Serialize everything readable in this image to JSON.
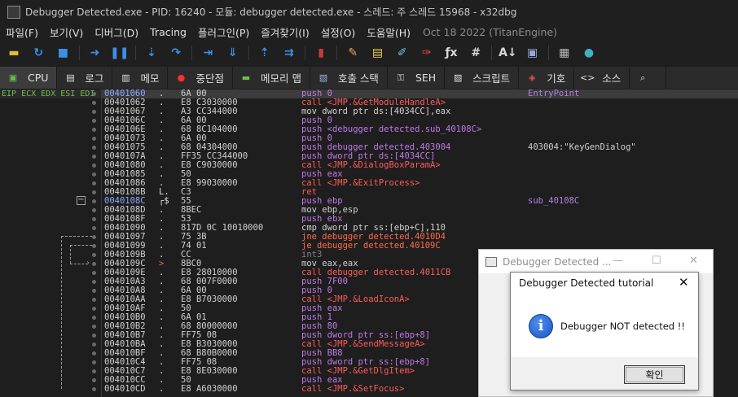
{
  "window": {
    "title": "Debugger Detected.exe - PID: 16240 - 모듈: debugger detected.exe - 스레드: 주 스레드 15968 - x32dbg"
  },
  "menu": {
    "items": [
      "파일(F)",
      "보기(V)",
      "디버그(D)",
      "Tracing",
      "플러그인(P)",
      "즐겨찾기(I)",
      "설정(O)",
      "도움말(H)"
    ],
    "engine": "Oct 18 2022 (TitanEngine)"
  },
  "toolbar": {
    "buttons": [
      {
        "name": "open-icon",
        "glyph": "▬",
        "color": "#e8b838"
      },
      {
        "name": "restart-icon",
        "glyph": "↻",
        "color": "#3c8fe8"
      },
      {
        "name": "stop-icon",
        "glyph": "■",
        "color": "#3c8fe8"
      },
      {
        "name": "sep"
      },
      {
        "name": "run-icon",
        "glyph": "➜",
        "color": "#3c8fe8"
      },
      {
        "name": "pause-icon",
        "glyph": "❚❚",
        "color": "#3c8fe8"
      },
      {
        "name": "sep"
      },
      {
        "name": "step-into-icon",
        "glyph": "⇣",
        "color": "#3c8fe8"
      },
      {
        "name": "step-over-icon",
        "glyph": "↷",
        "color": "#3c8fe8"
      },
      {
        "name": "sep"
      },
      {
        "name": "trace-into-icon",
        "glyph": "⇥",
        "color": "#3c8fe8"
      },
      {
        "name": "trace-over-icon",
        "glyph": "⇓",
        "color": "#3c8fe8"
      },
      {
        "name": "sep"
      },
      {
        "name": "execute-till-return-icon",
        "glyph": "⇡",
        "color": "#3c8fe8"
      },
      {
        "name": "run-to-user-code-icon",
        "glyph": "⇉",
        "color": "#3c8fe8"
      },
      {
        "name": "sep"
      },
      {
        "name": "scylla-icon",
        "glyph": "▮",
        "color": "#c83c3c"
      },
      {
        "name": "sep"
      },
      {
        "name": "patch-icon",
        "glyph": "✎",
        "color": "#e8a060"
      },
      {
        "name": "comments-icon",
        "glyph": "▤",
        "color": "#e8d048"
      },
      {
        "name": "labels-icon",
        "glyph": "✐",
        "color": "#70c0e0"
      },
      {
        "name": "bookmarks-icon",
        "glyph": "✑",
        "color": "#e84848"
      },
      {
        "name": "functions-icon",
        "glyph": "ƒx",
        "color": "#d8d8d8"
      },
      {
        "name": "variables-icon",
        "glyph": "#",
        "color": "#d8d8d8"
      },
      {
        "name": "sep"
      },
      {
        "name": "strings-icon",
        "glyph": "A↓",
        "color": "#d8d8d8"
      },
      {
        "name": "memory-icon",
        "glyph": "▣",
        "color": "#9aa8d8"
      },
      {
        "name": "sep"
      },
      {
        "name": "calculator-icon",
        "glyph": "▦",
        "color": "#b8b8b8"
      },
      {
        "name": "globe-icon",
        "glyph": "●",
        "color": "#40b0c0"
      }
    ]
  },
  "tabs": [
    {
      "label": "CPU",
      "icon": "cpu-icon",
      "glyph": "▣",
      "color": "#6fbf4a",
      "active": true
    },
    {
      "label": "로그",
      "icon": "log-icon",
      "glyph": "▤",
      "color": "#e0e0e0",
      "active": false
    },
    {
      "label": "메모",
      "icon": "notes-icon",
      "glyph": "▥",
      "color": "#e0e0e0",
      "active": false
    },
    {
      "label": "중단점",
      "icon": "breakpoint-icon",
      "glyph": "●",
      "color": "#ff3030",
      "active": false
    },
    {
      "label": "메모리 맵",
      "icon": "memory-map-icon",
      "glyph": "▬",
      "color": "#6fbf4a",
      "active": false
    },
    {
      "label": "호출 스택",
      "icon": "call-stack-icon",
      "glyph": "▧",
      "color": "#9ab0e0",
      "active": false
    },
    {
      "label": "SEH",
      "icon": "seh-icon",
      "glyph": "⚿",
      "color": "#e0e0e0",
      "active": false
    },
    {
      "label": "스크립트",
      "icon": "script-icon",
      "glyph": "▨",
      "color": "#e0e0e0",
      "active": false
    },
    {
      "label": "기호",
      "icon": "symbols-icon",
      "glyph": "◈",
      "color": "#e05050",
      "active": false
    },
    {
      "label": "소스",
      "icon": "source-icon",
      "glyph": "<>",
      "color": "#e0e0e0",
      "active": false
    },
    {
      "label": "",
      "icon": "search-icon",
      "glyph": "⌕",
      "color": "#e0e0e0",
      "active": false
    }
  ],
  "registers_header": "EIP ECX EDX ESI EDI",
  "disasm": {
    "rows": [
      {
        "addr": "00401060",
        "mark": ".",
        "bytes": "6A 00",
        "mn": "push",
        "ops": " 0",
        "cls": "mn-push",
        "cmt": "EntryPoint",
        "cmt_is_label": true,
        "eip": true,
        "sel": true
      },
      {
        "addr": "00401062",
        "mark": ".",
        "bytes": "E8 C3030000",
        "mn": "call",
        "ops": " <JMP.&GetModuleHandleA>",
        "cls": "mn-call"
      },
      {
        "addr": "00401067",
        "mark": ".",
        "bytes": "A3 CC344000",
        "mn": "mov",
        "ops": " dword ptr ds:[4034CC],eax",
        "cls": "mn-mov"
      },
      {
        "addr": "0040106C",
        "mark": ".",
        "bytes": "6A 00",
        "mn": "push",
        "ops": " 0",
        "cls": "mn-push"
      },
      {
        "addr": "0040106E",
        "mark": ".",
        "bytes": "68 8C104000",
        "mn": "push",
        "ops": " <debugger detected.sub_40108C>",
        "cls": "mn-push"
      },
      {
        "addr": "00401073",
        "mark": ".",
        "bytes": "6A 00",
        "mn": "push",
        "ops": " 0",
        "cls": "mn-push"
      },
      {
        "addr": "00401075",
        "mark": ".",
        "bytes": "68 04304000",
        "mn": "push",
        "ops": " debugger detected.403004",
        "cls": "mn-push",
        "cmt": "403004:\"KeyGenDialog\""
      },
      {
        "addr": "0040107A",
        "mark": ".",
        "bytes": "FF35 CC344000",
        "mn": "push",
        "ops": " dword ptr ds:[4034CC]",
        "cls": "mn-push"
      },
      {
        "addr": "00401080",
        "mark": ".",
        "bytes": "E8 C9030000",
        "mn": "call",
        "ops": " <JMP.&DialogBoxParamA>",
        "cls": "mn-call"
      },
      {
        "addr": "00401085",
        "mark": ".",
        "bytes": "50",
        "mn": "push",
        "ops": " eax",
        "cls": "mn-push"
      },
      {
        "addr": "00401086",
        "mark": ".",
        "bytes": "E8 99030000",
        "mn": "call",
        "ops": " <JMP.&ExitProcess>",
        "cls": "mn-call"
      },
      {
        "addr": "0040108B",
        "mark": "L.",
        "bytes": "C3",
        "mn": "ret",
        "ops": "",
        "cls": "mn-ret"
      },
      {
        "addr": "0040108C",
        "mark": "┌$",
        "bytes": "55",
        "mn": "push",
        "ops": " ebp",
        "cls": "mn-push",
        "cmt": "sub_40108C",
        "cmt_is_label": true,
        "label_addr": true
      },
      {
        "addr": "0040108D",
        "mark": ".",
        "bytes": "8BEC",
        "mn": "mov",
        "ops": " ebp,esp",
        "cls": "mn-mov"
      },
      {
        "addr": "0040108F",
        "mark": ".",
        "bytes": "53",
        "mn": "push",
        "ops": " ebx",
        "cls": "mn-push"
      },
      {
        "addr": "00401090",
        "mark": ".",
        "bytes": "817D 0C 10010000",
        "mn": "cmp",
        "ops": " dword ptr ss:[ebp+C],110",
        "cls": "mn-cmp"
      },
      {
        "addr": "00401097",
        "mark": ".",
        "bytes": "75 3B",
        "mn": "jne",
        "ops": " debugger detected.4010D4",
        "cls": "mn-jmp"
      },
      {
        "addr": "00401099",
        "mark": ".",
        "bytes": "74 01",
        "mn": "je",
        "ops": " debugger detected.40109C",
        "cls": "mn-jmp"
      },
      {
        "addr": "0040109B",
        "mark": ".",
        "bytes": "CC",
        "mn": "int3",
        "ops": "",
        "cls": "mn-int3"
      },
      {
        "addr": "0040109C",
        "mark": ">",
        "bytes": "8BC0",
        "mn": "mov",
        "ops": " eax,eax",
        "cls": "mn-mov",
        "arrow": true
      },
      {
        "addr": "0040109E",
        "mark": ".",
        "bytes": "E8 28010000",
        "mn": "call",
        "ops": " debugger detected.4011CB",
        "cls": "mn-call"
      },
      {
        "addr": "004010A3",
        "mark": ".",
        "bytes": "68 007F0000",
        "mn": "push",
        "ops": " 7F00",
        "cls": "mn-push"
      },
      {
        "addr": "004010A8",
        "mark": ".",
        "bytes": "6A 00",
        "mn": "push",
        "ops": " 0",
        "cls": "mn-push"
      },
      {
        "addr": "004010AA",
        "mark": ".",
        "bytes": "E8 B7030000",
        "mn": "call",
        "ops": " <JMP.&LoadIconA>",
        "cls": "mn-call"
      },
      {
        "addr": "004010AF",
        "mark": ".",
        "bytes": "50",
        "mn": "push",
        "ops": " eax",
        "cls": "mn-push"
      },
      {
        "addr": "004010B0",
        "mark": ".",
        "bytes": "6A 01",
        "mn": "push",
        "ops": " 1",
        "cls": "mn-push"
      },
      {
        "addr": "004010B2",
        "mark": ".",
        "bytes": "68 80000000",
        "mn": "push",
        "ops": " 80",
        "cls": "mn-push"
      },
      {
        "addr": "004010B7",
        "mark": ".",
        "bytes": "FF75 08",
        "mn": "push",
        "ops": " dword ptr ss:[ebp+8]",
        "cls": "mn-push"
      },
      {
        "addr": "004010BA",
        "mark": ".",
        "bytes": "E8 B3030000",
        "mn": "call",
        "ops": " <JMP.&SendMessageA>",
        "cls": "mn-call"
      },
      {
        "addr": "004010BF",
        "mark": ".",
        "bytes": "68 B80B0000",
        "mn": "push",
        "ops": " BB8",
        "cls": "mn-push"
      },
      {
        "addr": "004010C4",
        "mark": ".",
        "bytes": "FF75 08",
        "mn": "push",
        "ops": " dword ptr ss:[ebp+8]",
        "cls": "mn-push"
      },
      {
        "addr": "004010C7",
        "mark": ".",
        "bytes": "E8 8E030000",
        "mn": "call",
        "ops": " <JMP.&GetDlgItem>",
        "cls": "mn-call"
      },
      {
        "addr": "004010CC",
        "mark": ".",
        "bytes": "50",
        "mn": "push",
        "ops": " eax",
        "cls": "mn-push"
      },
      {
        "addr": "004010CD",
        "mark": ".",
        "bytes": "E8 A6030000",
        "mn": "call",
        "ops": " <JMP.&SetFocus>",
        "cls": "mn-call"
      }
    ]
  },
  "bg_window": {
    "title": "Debugger Detected ..."
  },
  "msgbox": {
    "title": "Debugger Detected tutorial",
    "message": "Debugger NOT detected !!",
    "ok_label": "확인"
  },
  "colors": {
    "call": "#ff5a5a",
    "push": "#c278e6",
    "jump": "#ff6a4a",
    "label": "#b07fe0",
    "eip_address": "#8fa8ff"
  }
}
